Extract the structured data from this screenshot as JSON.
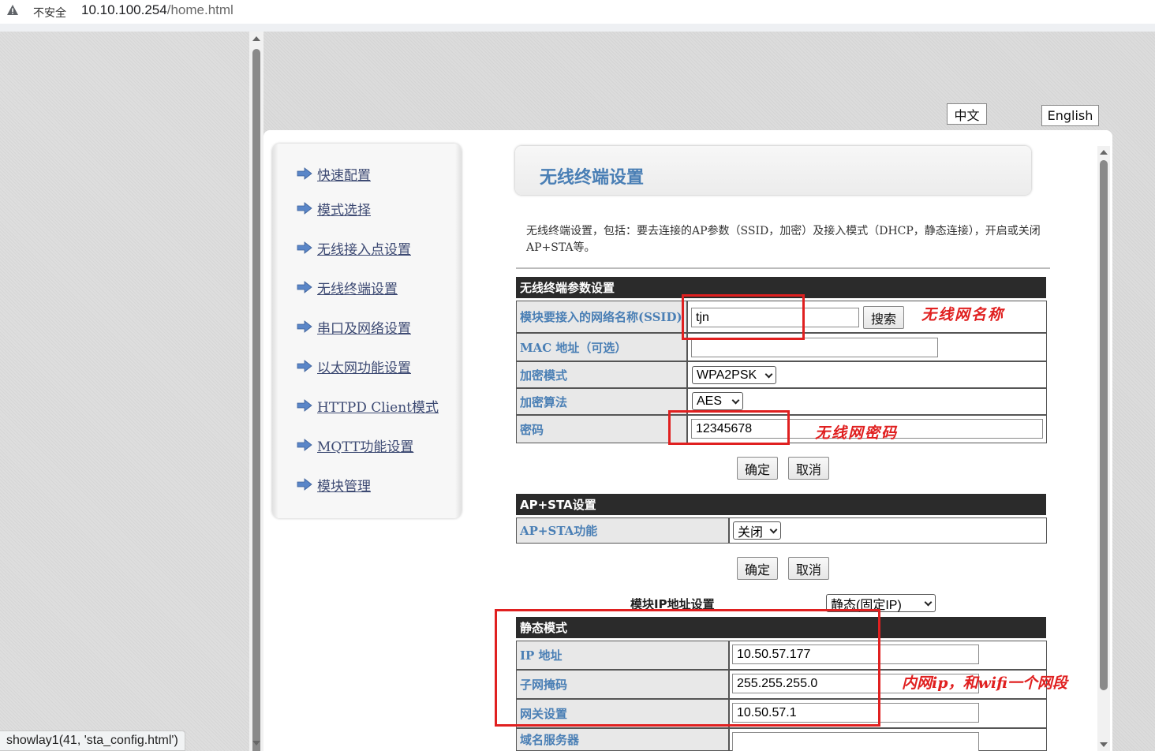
{
  "browser": {
    "security_label": "不安全",
    "url_host": "10.10.100.254",
    "url_path": "/home.html",
    "status_text": "showlay1(41, 'sta_config.html')"
  },
  "language": {
    "zh": "中文",
    "en": "English"
  },
  "sidebar": {
    "items": [
      {
        "label": "快速配置"
      },
      {
        "label": "模式选择"
      },
      {
        "label": "无线接入点设置"
      },
      {
        "label": "无线终端设置"
      },
      {
        "label": "串口及网络设置"
      },
      {
        "label": "以太网功能设置"
      },
      {
        "label": "HTTPD Client模式"
      },
      {
        "label": "MQTT功能设置"
      },
      {
        "label": "模块管理"
      }
    ]
  },
  "page": {
    "title": "无线终端设置",
    "description": "无线终端设置，包括：要去连接的AP参数（SSID，加密）及接入模式（DHCP，静态连接），开启或关闭 AP+STA等。"
  },
  "sta_params": {
    "header": "无线终端参数设置",
    "ssid_label": "模块要接入的网络名称(SSID)",
    "ssid_value": "tjn",
    "search_button": "搜索",
    "mac_label": "MAC 地址（可选）",
    "mac_value": "",
    "encrypt_mode_label": "加密模式",
    "encrypt_mode_value": "WPA2PSK",
    "encrypt_alg_label": "加密算法",
    "encrypt_alg_value": "AES",
    "password_label": "密码",
    "password_value": "12345678",
    "confirm": "确定",
    "cancel": "取消"
  },
  "apsta": {
    "header": "AP+STA设置",
    "label": "AP+STA功能",
    "value": "关闭",
    "confirm": "确定",
    "cancel": "取消"
  },
  "ip": {
    "mode_label": "模块IP地址设置",
    "mode_value": "静态(固定IP)",
    "static_header": "静态模式",
    "ip_label": "IP 地址",
    "ip_value": "10.50.57.177",
    "mask_label": "子网掩码",
    "mask_value": "255.255.255.0",
    "gateway_label": "网关设置",
    "gateway_value": "10.50.57.1",
    "dns_label": "域名服务器",
    "dns_value": ""
  },
  "annotations": {
    "ssid_note": "无线网名称",
    "password_note": "无线网密码",
    "ip_note": "内网ip，和wifi一个网段"
  },
  "colors": {
    "annotation": "#e02020",
    "label_text": "#4a7fb5",
    "section_header": "#2b2b2b"
  }
}
